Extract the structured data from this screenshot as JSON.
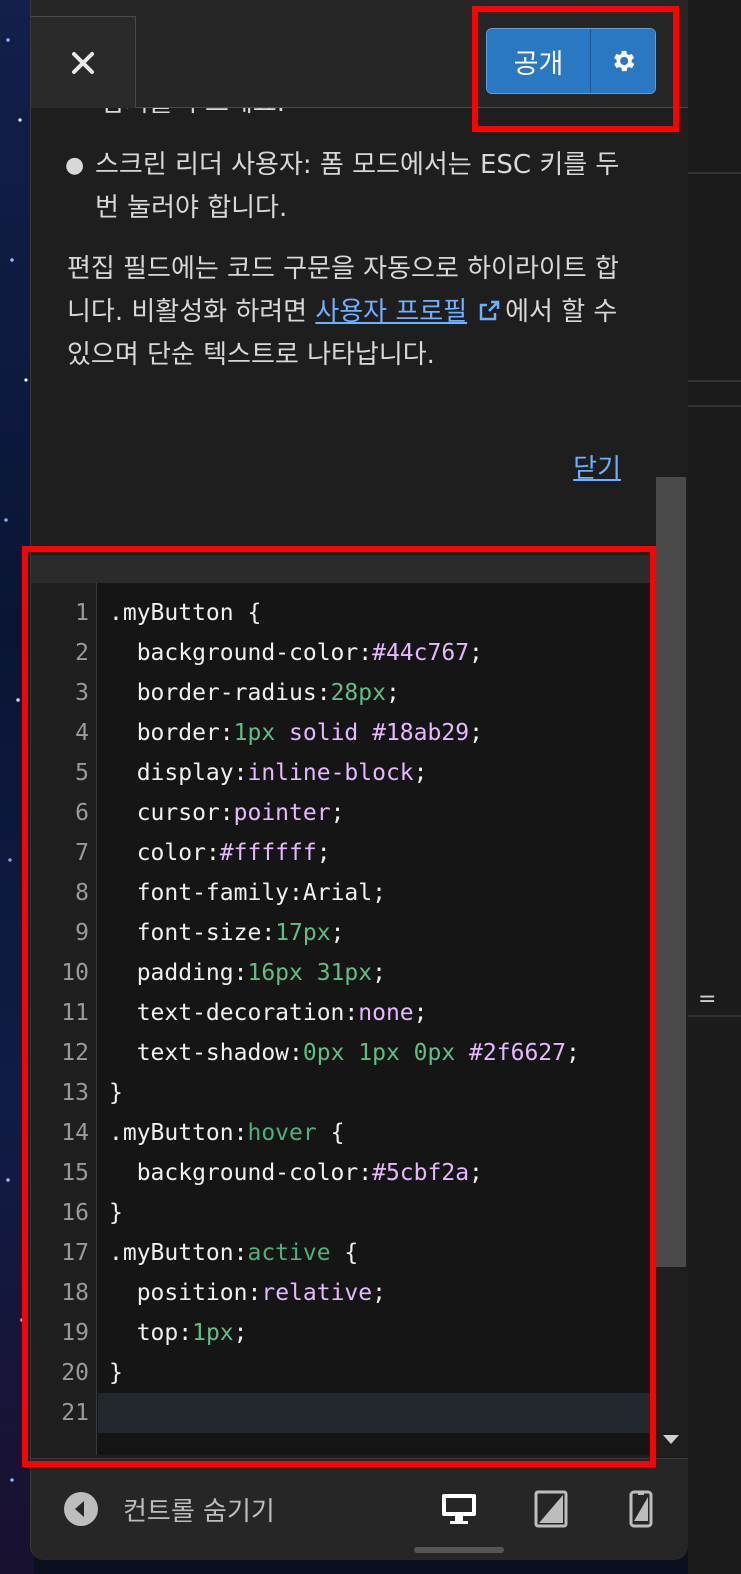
{
  "toolbar": {
    "close_icon": "close-icon",
    "publish_label": "공개",
    "settings_icon": "gear-icon"
  },
  "help": {
    "cut_line": "납거를 누르세요.",
    "bullet_text": "스크린 리더 사용자: 폼 모드에서는 ESC 키를 두 번 눌러야 합니다.",
    "para_before": "편집 필드에는 코드 구문을 자동으로 하이라이트 합니다. 비활성화 하려면 ",
    "para_link": "사용자 프로필",
    "para_after": "에서 할 수 있으며 단순 텍스트로 나타납니다.",
    "close_link": "닫기"
  },
  "editor": {
    "lines": [
      {
        "n": "1",
        "parts": [
          [
            "sel",
            ".myButton"
          ],
          [
            "punc",
            " {"
          ]
        ]
      },
      {
        "n": "2",
        "parts": [
          [
            "prop",
            "  background-color"
          ],
          [
            "punc",
            ":"
          ],
          [
            "val",
            "#44c767"
          ],
          [
            "punc",
            ";"
          ]
        ]
      },
      {
        "n": "3",
        "parts": [
          [
            "prop",
            "  border-radius"
          ],
          [
            "punc",
            ":"
          ],
          [
            "num",
            "28px"
          ],
          [
            "punc",
            ";"
          ]
        ]
      },
      {
        "n": "4",
        "parts": [
          [
            "prop",
            "  border"
          ],
          [
            "punc",
            ":"
          ],
          [
            "num",
            "1px"
          ],
          [
            "val",
            " solid #18ab29"
          ],
          [
            "punc",
            ";"
          ]
        ]
      },
      {
        "n": "5",
        "parts": [
          [
            "prop",
            "  display"
          ],
          [
            "punc",
            ":"
          ],
          [
            "val",
            "inline-block"
          ],
          [
            "punc",
            ";"
          ]
        ]
      },
      {
        "n": "6",
        "parts": [
          [
            "prop",
            "  cursor"
          ],
          [
            "punc",
            ":"
          ],
          [
            "val",
            "pointer"
          ],
          [
            "punc",
            ";"
          ]
        ]
      },
      {
        "n": "7",
        "parts": [
          [
            "prop",
            "  color"
          ],
          [
            "punc",
            ":"
          ],
          [
            "val",
            "#ffffff"
          ],
          [
            "punc",
            ";"
          ]
        ]
      },
      {
        "n": "8",
        "parts": [
          [
            "prop",
            "  font-family"
          ],
          [
            "punc",
            ":"
          ],
          [
            "prop",
            "Arial"
          ],
          [
            "punc",
            ";"
          ]
        ]
      },
      {
        "n": "9",
        "parts": [
          [
            "prop",
            "  font-size"
          ],
          [
            "punc",
            ":"
          ],
          [
            "num",
            "17px"
          ],
          [
            "punc",
            ";"
          ]
        ]
      },
      {
        "n": "10",
        "parts": [
          [
            "prop",
            "  padding"
          ],
          [
            "punc",
            ":"
          ],
          [
            "num",
            "16px 31px"
          ],
          [
            "punc",
            ";"
          ]
        ]
      },
      {
        "n": "11",
        "parts": [
          [
            "prop",
            "  text-decoration"
          ],
          [
            "punc",
            ":"
          ],
          [
            "val",
            "none"
          ],
          [
            "punc",
            ";"
          ]
        ]
      },
      {
        "n": "12",
        "parts": [
          [
            "prop",
            "  text-shadow"
          ],
          [
            "punc",
            ":"
          ],
          [
            "num",
            "0px 1px 0px"
          ],
          [
            "val",
            " #2f6627"
          ],
          [
            "punc",
            ";"
          ]
        ]
      },
      {
        "n": "13",
        "parts": [
          [
            "punc",
            "}"
          ]
        ]
      },
      {
        "n": "14",
        "parts": [
          [
            "sel",
            ".myButton"
          ],
          [
            "punc",
            ":"
          ],
          [
            "pseudo",
            "hover"
          ],
          [
            "punc",
            " {"
          ]
        ]
      },
      {
        "n": "15",
        "parts": [
          [
            "prop",
            "  background-color"
          ],
          [
            "punc",
            ":"
          ],
          [
            "val",
            "#5cbf2a"
          ],
          [
            "punc",
            ";"
          ]
        ]
      },
      {
        "n": "16",
        "parts": [
          [
            "punc",
            "}"
          ]
        ]
      },
      {
        "n": "17",
        "parts": [
          [
            "sel",
            ".myButton"
          ],
          [
            "punc",
            ":"
          ],
          [
            "pseudo",
            "active"
          ],
          [
            "punc",
            " {"
          ]
        ]
      },
      {
        "n": "18",
        "parts": [
          [
            "prop",
            "  position"
          ],
          [
            "punc",
            ":"
          ],
          [
            "val",
            "relative"
          ],
          [
            "punc",
            ";"
          ]
        ]
      },
      {
        "n": "19",
        "parts": [
          [
            "prop",
            "  top"
          ],
          [
            "punc",
            ":"
          ],
          [
            "num",
            "1px"
          ],
          [
            "punc",
            ";"
          ]
        ]
      },
      {
        "n": "20",
        "parts": [
          [
            "punc",
            "}"
          ]
        ]
      },
      {
        "n": "21",
        "parts": []
      }
    ],
    "active_line": 21
  },
  "bottombar": {
    "hide_label": "컨트롤 숨기기",
    "devices": [
      "desktop-icon",
      "tablet-icon",
      "mobile-icon"
    ]
  },
  "colors": {
    "publish_button": "#2a78c2",
    "link": "#6fb0ff",
    "highlight_box": "#ff0000"
  }
}
